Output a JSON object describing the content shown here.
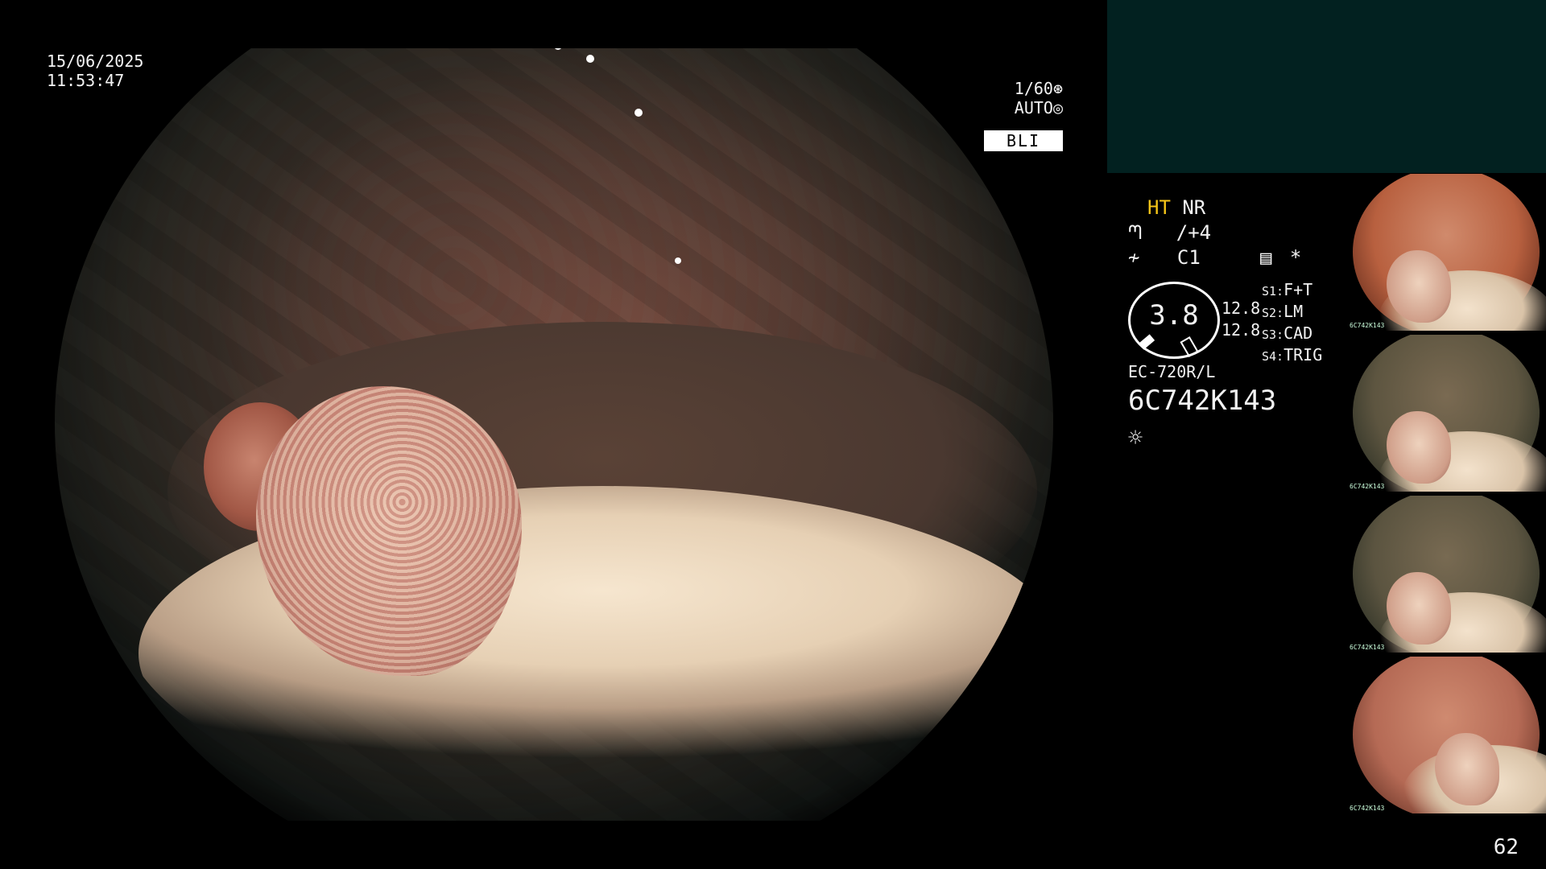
{
  "overlay": {
    "date": "15/06/2025",
    "time": "11:53:47",
    "shutter": "1/60",
    "shutter_icon": "shutter-icon",
    "iris": "AUTO",
    "iris_icon": "iris-icon",
    "mode": "BLI"
  },
  "settings": {
    "ht": "HT",
    "nr": "NR",
    "enhance_icon": "enhance-curve-icon",
    "enhance_value": "/+4",
    "color_icon": "color-curve-icon",
    "color_value": "C1",
    "record_icon": "record-icon",
    "asterisk": "*",
    "zoom_value": "3.8",
    "measure_1": "12.8",
    "measure_2": "12.8",
    "switches": [
      {
        "key": "S1:",
        "value": "F+T"
      },
      {
        "key": "S2:",
        "value": "LM"
      },
      {
        "key": "S3:",
        "value": "CAD"
      },
      {
        "key": "S4:",
        "value": "TRIG"
      }
    ],
    "scope_model": "EC-720R/L",
    "scope_serial": "6C742K143",
    "light_icon": "light-sun-icon"
  },
  "thumbnails": [
    {
      "label": "6C742K143",
      "tone": "#b8603f"
    },
    {
      "label": "6C742K143",
      "tone": "#5d5540"
    },
    {
      "label": "6C742K143",
      "tone": "#5b5440"
    },
    {
      "label": "6C742K143",
      "tone": "#b56a55"
    }
  ],
  "footer": {
    "frame_count": "62"
  },
  "colors": {
    "ht_accent": "#f5c518",
    "top_panel": "#022120"
  }
}
